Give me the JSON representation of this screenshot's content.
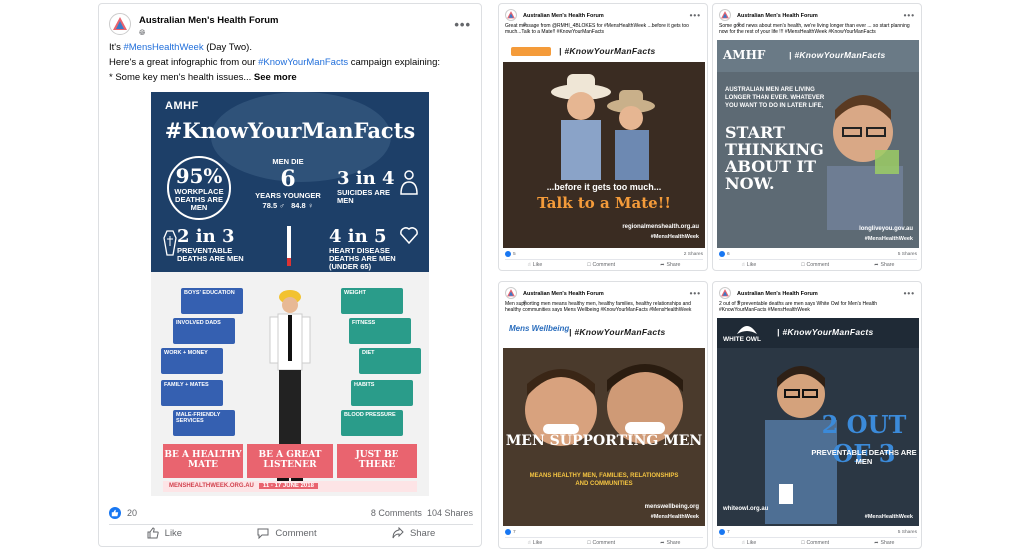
{
  "colors": {
    "facebook_blue": "#1877f2",
    "link": "#216fdb",
    "muted": "#65676b",
    "infographic_navy": "#1a3f6c",
    "banner_pink": "#e9646f",
    "orange": "#f49b3a"
  },
  "main_post": {
    "page_name": "Australian Men's Health Forum",
    "visibility_icon": "globe-icon",
    "more_icon": "•••",
    "line1_prefix": "It's ",
    "line1_hashtag": "#MensHealthWeek",
    "line1_suffix": " (Day Two).",
    "line2_prefix": "Here's a great infographic from our ",
    "line2_hashtag": "#KnowYourManFacts",
    "line2_suffix": " campaign explaining:",
    "line3": "* Some key men's health issues...",
    "see_more": "See more",
    "infographic": {
      "brand": "AMHF",
      "headline": "#KnowYourManFacts",
      "stat1_big": "95%",
      "stat1_text": "WORKPLACE DEATHS ARE MEN",
      "stat2_head": "MEN DIE",
      "stat2_big": "6",
      "stat2_text": "YEARS YOUNGER",
      "stat2_male": "78.5",
      "stat2_female": "84.8",
      "stat3_big": "3 in 4",
      "stat3_text": "SUICIDES ARE MEN",
      "stat4_big": "2 in 3",
      "stat4_text": "PREVENTABLE DEATHS ARE MEN",
      "stat5_big": "4 in 5",
      "stat5_text": "HEART DISEASE DEATHS ARE MEN (UNDER 65)",
      "left_boxes": [
        "BOYS' EDUCATION",
        "INVOLVED DADS",
        "WORK + MONEY",
        "FAMILY + MATES",
        "MALE-FRIENDLY SERVICES"
      ],
      "right_boxes": [
        "WEIGHT",
        "FITNESS",
        "DIET",
        "HABITS",
        "BLOOD PRESSURE"
      ],
      "banner1": "BE A HEALTHY MATE",
      "banner2": "BE A GREAT LISTENER",
      "banner3": "JUST BE THERE",
      "url": "MENSHEALTHWEEK.ORG.AU",
      "dates": "11 - 17 JUNE 2018"
    },
    "reactions": "20",
    "comments": "8 Comments",
    "shares": "104 Shares",
    "like_label": "Like",
    "comment_label": "Comment",
    "share_label": "Share"
  },
  "posts": [
    {
      "page_name": "Australian Men's Health Forum",
      "text": "Great message from @RMHI_4BLOKES for #MensHealthWeek ...before it gets too much...Talk to a Mate!! #KnowYourManFacts",
      "hashtag": "| #KnowYourManFacts",
      "caption1": "...before it gets too much...",
      "caption2": "Talk to a Mate!!",
      "site": "regionalmenshealth.org.au",
      "tag": "#MensHealthWeek",
      "reactions": "5",
      "shares": "2 Shares",
      "like_label": "Like",
      "comment_label": "Comment",
      "share_label": "Share"
    },
    {
      "page_name": "Australian Men's Health Forum",
      "text": "Some good news about men's health, we're living longer than ever ... so start planning now for the rest of your life !!! #MensHealthWeek #KnowYourManFacts",
      "hashtag": "| #KnowYourManFacts",
      "brand": "AMHF",
      "caption1": "AUSTRALIAN MEN ARE LIVING LONGER THAN EVER. WHATEVER YOU WANT TO DO IN LATER LIFE,",
      "caption2": "START THINKING ABOUT IT NOW.",
      "site": "longliveyou.gov.au",
      "tag": "#MensHealthWeek",
      "reactions": "6",
      "shares": "5 Shares",
      "like_label": "Like",
      "comment_label": "Comment",
      "share_label": "Share"
    },
    {
      "page_name": "Australian Men's Health Forum",
      "text": "Men supporting men means healthy men, healthy families, healthy relationships and healthy communities says Mens Wellbeing #KnowYourManFacts #MensHealthWeek",
      "hashtag": "| #KnowYourManFacts",
      "brand": "Mens Wellbeing",
      "caption1": "MEN SUPPORTING MEN",
      "caption2": "MEANS HEALTHY MEN, FAMILIES, RELATIONSHIPS AND COMMUNITIES",
      "site": "menswellbeing.org",
      "tag": "#MensHealthWeek",
      "reactions": "7",
      "shares": "",
      "like_label": "Like",
      "comment_label": "Comment",
      "share_label": "Share"
    },
    {
      "page_name": "Australian Men's Health Forum",
      "text": "2 out of 3 preventable deaths are men says White Owl for Men's Health #KnowYourManFacts #MensHealthWeek",
      "hashtag": "| #KnowYourManFacts",
      "brand": "WHITE OWL",
      "big": "2 OUT OF 3",
      "caption1": "PREVENTABLE DEATHS ARE MEN",
      "site": "whiteowl.org.au",
      "tag": "#MensHealthWeek",
      "reactions": "7",
      "shares": "5 Shares",
      "like_label": "Like",
      "comment_label": "Comment",
      "share_label": "Share"
    }
  ]
}
